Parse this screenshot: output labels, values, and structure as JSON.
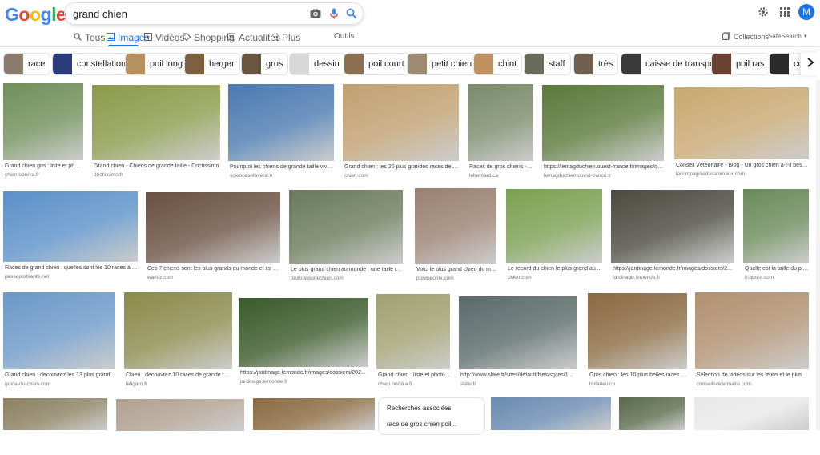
{
  "header": {
    "logo": [
      "G",
      "o",
      "o",
      "g",
      "l",
      "e"
    ],
    "logo_colors": [
      "#4285f4",
      "#ea4335",
      "#fbbc05",
      "#4285f4",
      "#34a853",
      "#ea4335"
    ],
    "query": "grand chien",
    "avatar_letter": "M"
  },
  "tabs": [
    {
      "label": "Tous",
      "icon": "search-icon",
      "active": false
    },
    {
      "label": "Images",
      "icon": "image-icon",
      "active": true
    },
    {
      "label": "Vidéos",
      "icon": "video-icon",
      "active": false
    },
    {
      "label": "Shopping",
      "icon": "tag-icon",
      "active": false
    },
    {
      "label": "Actualités",
      "icon": "news-icon",
      "active": false
    },
    {
      "label": "Plus",
      "icon": "more-vert-icon",
      "active": false
    }
  ],
  "tools": {
    "outils": "Outils",
    "collections": "Collections",
    "safesearch": "SafeSearch"
  },
  "chips": [
    {
      "label": "race",
      "color": "#8a7a6a"
    },
    {
      "label": "constellation",
      "color": "#2a3a7a"
    },
    {
      "label": "poil long",
      "color": "#b89060"
    },
    {
      "label": "berger",
      "color": "#7a6040"
    },
    {
      "label": "gros",
      "color": "#6a5540"
    },
    {
      "label": "dessin",
      "color": "#d8d8d8"
    },
    {
      "label": "poil court",
      "color": "#8a7050"
    },
    {
      "label": "petit chien",
      "color": "#a08a70"
    },
    {
      "label": "chiot",
      "color": "#c09060"
    },
    {
      "label": "staff",
      "color": "#6a6a5a"
    },
    {
      "label": "très",
      "color": "#706050"
    },
    {
      "label": "caisse de transport",
      "color": "#3a3a3a"
    },
    {
      "label": "poil ras",
      "color": "#6a4030"
    },
    {
      "label": "coll",
      "color": "#2a2a2a"
    }
  ],
  "results": [
    {
      "title": "Grand chien gris : liste et phot...",
      "source": "chien.ooreka.fr",
      "color": "#6f8f5a"
    },
    {
      "title": "Grand chien - Chiens de grande taille - Doctissimo",
      "source": "doctissimo.fr",
      "color": "#8a9a4a"
    },
    {
      "title": "Pourquoi les chiens de grande taille viven...",
      "source": "sciencesetavenir.fr",
      "color": "#4a7ab0"
    },
    {
      "title": "Grand chien : les 20 plus grandes races de chi...",
      "source": "chien.com",
      "color": "#c0a070"
    },
    {
      "title": "Races de gros chiens - l...",
      "source": "lebernard.ca",
      "color": "#7a8a6a"
    },
    {
      "title": "https://lemagduchien.ouest-france.fr/images/do...",
      "source": "lemagduchien.ouest-france.fr",
      "color": "#5a7a3a"
    },
    {
      "title": "Conseil Vétérinaire - Blog - Un gros chien a-t-il besoin ...",
      "source": "lacompagniedesanimaux.com",
      "color": "#c8a870"
    },
    {
      "title": "Races de grand chien : quelles sont les 10 races à co...",
      "source": "passeportsante.net",
      "color": "#5a90c8"
    },
    {
      "title": "Ces 7 chiens sont les plus grands du monde et ils so...",
      "source": "wamiz.com",
      "color": "#6a5040"
    },
    {
      "title": "Le plus grand chien au monde : une taille incr...",
      "source": "toutoupourlechien.com",
      "color": "#6a7a5a"
    },
    {
      "title": "Voici le plus grand chien du mo...",
      "source": "purepeople.com",
      "color": "#9a8070"
    },
    {
      "title": "Le record du chien le plus grand au ...",
      "source": "chien.com",
      "color": "#7aa050"
    },
    {
      "title": "https://jardinage.lemonde.fr/images/dossiers/2...",
      "source": "jardinage.lemonde.fr",
      "color": "#4a4a40"
    },
    {
      "title": "Quelle est la taille du plu...",
      "source": "fr.quora.com",
      "color": "#6a8a5a"
    },
    {
      "title": "Grand chien : découvrez les 13 plus grand...",
      "source": "guide-du-chien.com",
      "color": "#6a98c8"
    },
    {
      "title": "Chien : découvrez 10 races de grande taille",
      "source": "lefigaro.fr",
      "color": "#8a8a4a"
    },
    {
      "title": "https://jardinage.lemonde.fr/images/dossiers/202...",
      "source": "jardinage.lemonde.fr",
      "color": "#3a5a2a"
    },
    {
      "title": "Grand chien : liste et photo...",
      "source": "chien.ooreka.fr",
      "color": "#a0a070"
    },
    {
      "title": "http://www.slate.fr/sites/default/files/styles/1...",
      "source": "slate.fr",
      "color": "#5a6a6a"
    },
    {
      "title": "Gros chien : les 10 plus belles races (+...",
      "source": "botaneo.co",
      "color": "#8a6a40"
    },
    {
      "title": "Sélection de vidéos sur les félins et le plus g...",
      "source": "conseilsveterinaire.com",
      "color": "#b09070"
    },
    {
      "title": "",
      "source": "",
      "color": "#8a8060"
    },
    {
      "title": "",
      "source": "",
      "color": "#b0a090"
    },
    {
      "title": "",
      "source": "",
      "color": "#8a6a40"
    },
    {
      "title": "",
      "source": "",
      "color": "#6a8ab0"
    },
    {
      "title": "",
      "source": "",
      "color": "#5a6a4a"
    },
    {
      "title": "",
      "source": "",
      "color": "#e8e8e8"
    }
  ],
  "related": {
    "title": "Recherches associées",
    "item": "race de gros chien poil..."
  }
}
